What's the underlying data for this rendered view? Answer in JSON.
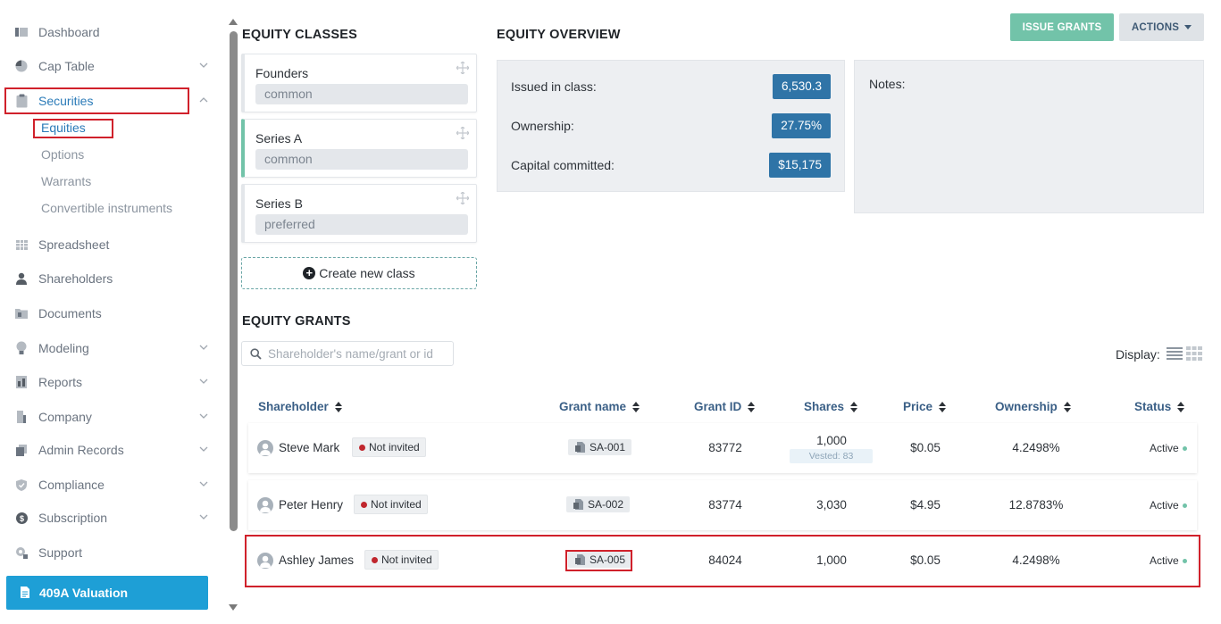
{
  "sidebar": {
    "items": [
      {
        "label": "Dashboard",
        "icon": "dashboard-icon"
      },
      {
        "label": "Cap Table",
        "icon": "pie-chart-icon"
      },
      {
        "label": "Securities",
        "icon": "clipboard-icon"
      },
      {
        "label": "Spreadsheet",
        "icon": "table-icon"
      },
      {
        "label": "Shareholders",
        "icon": "person-icon"
      },
      {
        "label": "Documents",
        "icon": "folder-icon"
      },
      {
        "label": "Modeling",
        "icon": "lightbulb-icon"
      },
      {
        "label": "Reports",
        "icon": "report-icon"
      },
      {
        "label": "Company",
        "icon": "building-icon"
      },
      {
        "label": "Admin Records",
        "icon": "records-icon"
      },
      {
        "label": "Compliance",
        "icon": "shield-icon"
      },
      {
        "label": "Subscription",
        "icon": "dollar-icon"
      },
      {
        "label": "Support",
        "icon": "support-icon"
      }
    ],
    "securities_sub": [
      "Equities",
      "Options",
      "Warrants",
      "Convertible instruments"
    ],
    "valuation_label": "409A Valuation"
  },
  "classes": {
    "title": "EQUITY CLASSES",
    "items": [
      {
        "name": "Founders",
        "type": "common"
      },
      {
        "name": "Series A",
        "type": "common"
      },
      {
        "name": "Series B",
        "type": "preferred"
      }
    ],
    "create_label": "Create new class"
  },
  "overview": {
    "title": "EQUITY OVERVIEW",
    "issued_label": "Issued in class:",
    "issued_value": "6,530.3",
    "ownership_label": "Ownership:",
    "ownership_value": "27.75%",
    "capital_label": "Capital committed:",
    "capital_value": "$15,175",
    "notes_label": "Notes:"
  },
  "toolbar": {
    "issue_label": "ISSUE GRANTS",
    "actions_label": "ACTIONS"
  },
  "grants": {
    "title": "EQUITY GRANTS",
    "search_placeholder": "Shareholder's name/grant or id",
    "display_label": "Display:",
    "columns": [
      "Shareholder",
      "Grant name",
      "Grant ID",
      "Shares",
      "Price",
      "Ownership",
      "Status"
    ],
    "rows": [
      {
        "shareholder": "Steve Mark",
        "invite": "Not invited",
        "grant_name": "SA-001",
        "grant_id": "83772",
        "shares": "1,000",
        "vested": "Vested: 83",
        "price": "$0.05",
        "ownership": "4.2498%",
        "status": "Active"
      },
      {
        "shareholder": "Peter Henry",
        "invite": "Not invited",
        "grant_name": "SA-002",
        "grant_id": "83774",
        "shares": "3,030",
        "vested": "",
        "price": "$4.95",
        "ownership": "12.8783%",
        "status": "Active"
      },
      {
        "shareholder": "Ashley James",
        "invite": "Not invited",
        "grant_name": "SA-005",
        "grant_id": "84024",
        "shares": "1,000",
        "vested": "",
        "price": "$0.05",
        "ownership": "4.2498%",
        "status": "Active"
      }
    ]
  },
  "colors": {
    "accent_blue": "#2b7bb8",
    "teal": "#72c3a9",
    "badge_blue": "#2f74a7",
    "highlight_red": "#d0212b",
    "valuation_blue": "#1e9fd6"
  }
}
